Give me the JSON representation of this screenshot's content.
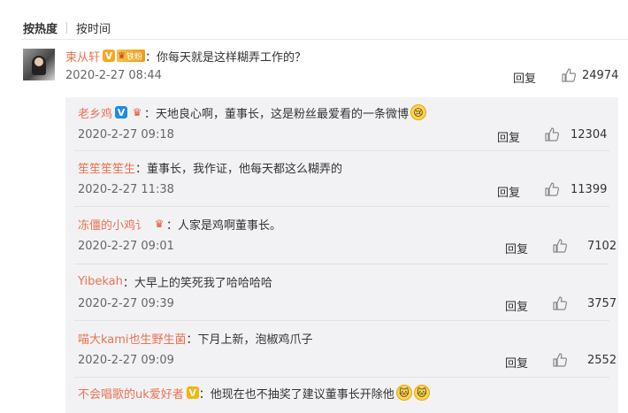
{
  "sort": {
    "hot": "按热度",
    "time": "按时间"
  },
  "main": {
    "user": "柬从轩",
    "fan_badge": "铁粉",
    "text": "：你每天就是这样糊弄工作的？",
    "date": "2020-2-27 08:44",
    "reply": "回复",
    "likes": "24974"
  },
  "replies": [
    {
      "user": "老乡鸡",
      "badge": "V",
      "badge_color": "#1f8be0",
      "crown": true,
      "text": "：天地良心啊，董事长，这是粉丝最爱看的一条微博",
      "emoji": "😢",
      "date": "2020-2-27 09:18",
      "reply": "回复",
      "likes": "12304"
    },
    {
      "user": "笙笙笙笙生",
      "badge": "",
      "crown": false,
      "text": "：董事长，我作证，他每天都这么糊弄的",
      "emoji": "",
      "date": "2020-2-27 11:38",
      "reply": "回复",
      "likes": "11399"
    },
    {
      "user": "冻僵的小鸡讠",
      "badge": "",
      "crown": true,
      "text": "：人家是鸡啊董事长。",
      "emoji": "",
      "date": "2020-2-27 09:01",
      "reply": "回复",
      "likes": "7102"
    },
    {
      "user": "Yibekah",
      "badge": "",
      "crown": false,
      "text": "：大早上的笑死我了哈哈哈哈",
      "emoji": "",
      "date": "2020-2-27 09:39",
      "reply": "回复",
      "likes": "3757"
    },
    {
      "user": "喵大kami也生野生菌",
      "badge": "",
      "crown": false,
      "text": "：下月上新，泡椒鸡爪子",
      "emoji": "",
      "date": "2020-2-27 09:09",
      "reply": "回复",
      "likes": "2552"
    },
    {
      "user": "不会唱歌的uk爱好者",
      "badge": "V",
      "badge_color": "#f5b50a",
      "crown": false,
      "text": "：他现在也不抽奖了建议董事长开除他",
      "emoji": "🐱🐱",
      "date": "",
      "reply": "",
      "likes": ""
    }
  ]
}
